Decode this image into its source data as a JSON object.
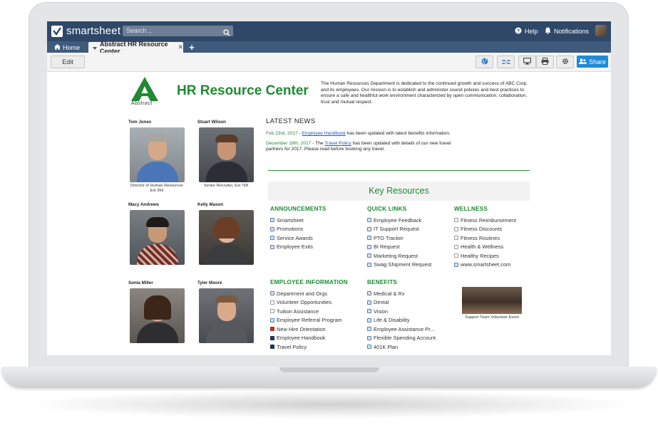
{
  "app": {
    "brand": "smartsheet",
    "accent": "#2f4868",
    "green": "#1f8a33"
  },
  "topbar": {
    "search_placeholder": "Search...",
    "help_label": "Help",
    "notifications_label": "Notifications"
  },
  "tabs": {
    "home_label": "Home",
    "active_label": "Abstract HR Resource Center"
  },
  "toolbar": {
    "edit_label": "Edit",
    "share_label": "Share"
  },
  "page": {
    "logo_text": "Abstract",
    "title": "HR Resource Center",
    "intro": "The Human Resources Department is dedicated to the continued growth and success of ABC Corp. and its employees. Our mission is to establish and administer sound policies and best practices to ensure a safe and healthful work environment characterized by open communication, collaboration, trust and mutual respect."
  },
  "people": [
    {
      "name": "Tom Jones",
      "title": "Director of Human Resources Ext 356"
    },
    {
      "name": "Stuart Wilson",
      "title": "Senior Recruiter, Ext 768"
    },
    {
      "name": "Macy Andrews",
      "title": ""
    },
    {
      "name": "Kelly Mason",
      "title": ""
    },
    {
      "name": "Sonia Miller",
      "title": ""
    },
    {
      "name": "Tyler Moore",
      "title": ""
    }
  ],
  "news": {
    "title": "LATEST NEWS",
    "items": [
      {
        "date": "Feb 23rd, 2017",
        "sep": " - ",
        "link": "Employee Handbook",
        "text": " has been updated with latest benefits information."
      },
      {
        "date": "December 18th, 2017",
        "sep": " - The ",
        "link": "Travel Policy",
        "text": " has been updated with details of our new travel partners for 2017. Please read before booking any travel."
      }
    ]
  },
  "key_resources": {
    "title": "Key Resources",
    "announcements": {
      "heading": "ANNOUNCEMENTS",
      "items": [
        "Smartsheet",
        "Promotions",
        "Service Awards",
        "Employee Exits"
      ]
    },
    "quick_links": {
      "heading": "QUICK LINKS",
      "items": [
        "Employee Feedback",
        "IT Support Request",
        "PTO Tracker",
        "BI Request",
        "Marketing Request",
        "Swag Shipment Request"
      ]
    },
    "wellness": {
      "heading": "WELLNESS",
      "items": [
        "Fitness Reimbursement",
        "Fitness Discounts",
        "Fitness Routines",
        "Health & Wellness",
        "Healthy Recipes",
        "www.smartsheet.com"
      ]
    },
    "employee_information": {
      "heading": "EMPLOYEE INFORMATION",
      "items": [
        "Department and Orgs",
        "Volunteer Opportunities",
        "Tuition Assistance",
        "Employee Referral Program",
        "New Hire Orientation",
        "Employee Handbook",
        "Travel Policy"
      ]
    },
    "benefits": {
      "heading": "BENEFITS",
      "items": [
        "Medical & Rx",
        "Dental",
        "Vision",
        "Life & Disability",
        "Employee Assistance Pr...",
        "Flexible Spending Account",
        "401K Plan"
      ]
    },
    "volunteer_caption": "Support Team Volunteer Event"
  }
}
